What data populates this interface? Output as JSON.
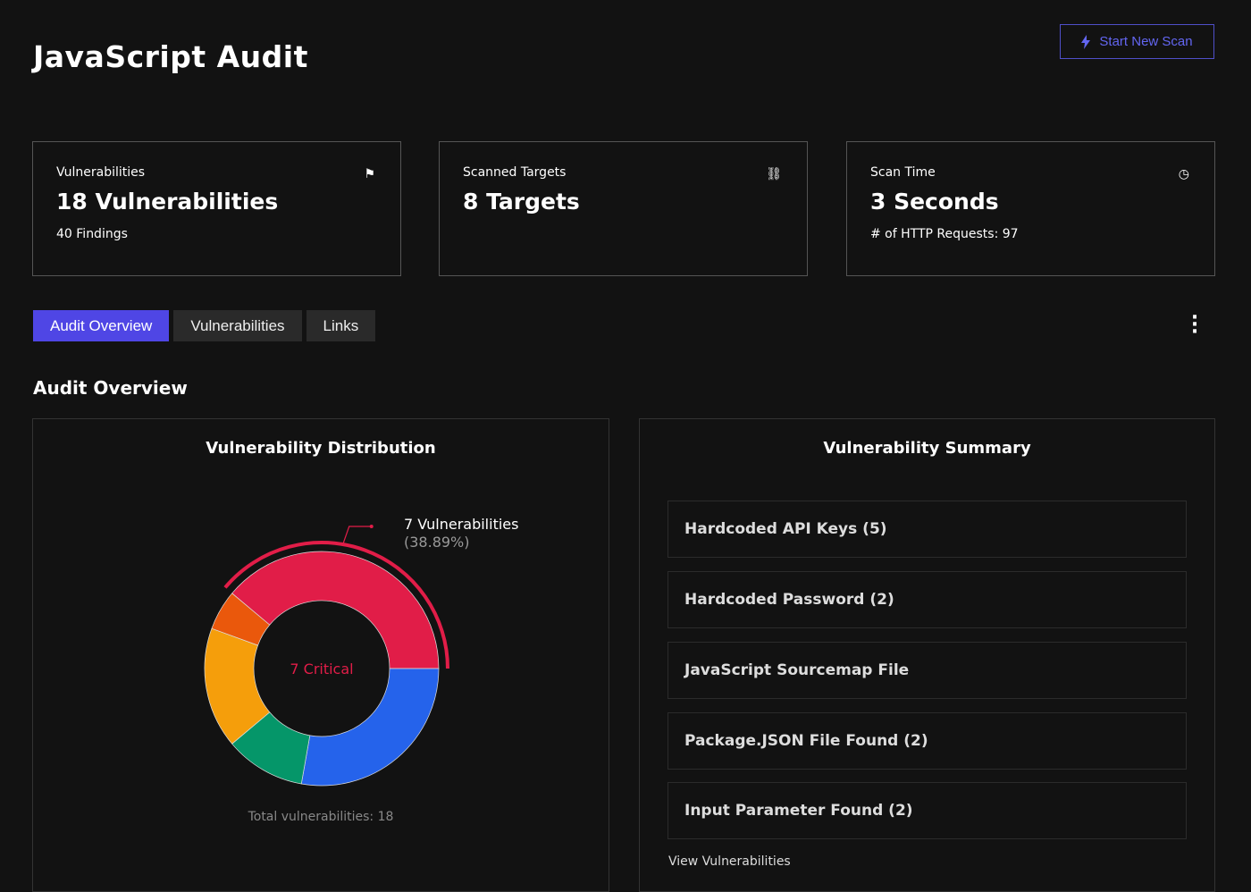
{
  "header": {
    "title": "JavaScript Audit",
    "scan_button": "Start New Scan"
  },
  "cards": [
    {
      "label": "Vulnerabilities",
      "value": "18 Vulnerabilities",
      "sub": "40 Findings",
      "icon": "flag-icon"
    },
    {
      "label": "Scanned Targets",
      "value": "8 Targets",
      "sub": "",
      "icon": "link-icon"
    },
    {
      "label": "Scan Time",
      "value": "3 Seconds",
      "sub": "# of HTTP Requests: 97",
      "icon": "clock-icon"
    }
  ],
  "tabs": [
    {
      "label": "Audit Overview",
      "active": true
    },
    {
      "label": "Vulnerabilities"
    },
    {
      "label": "Links"
    }
  ],
  "section_title": "Audit Overview",
  "distribution": {
    "title": "Vulnerability Distribution",
    "center_label": "7 Critical",
    "callout_value": "7 Vulnerabilities",
    "callout_percent": "(38.89%)",
    "total": "Total vulnerabilities: 18"
  },
  "chart_data": {
    "type": "pie",
    "variant": "donut",
    "values": [
      7,
      5,
      2,
      3,
      1
    ],
    "colors": [
      "#e11d48",
      "#2563eb",
      "#059669",
      "#f59e0b",
      "#ea580c"
    ],
    "highlighted_index": 0
  },
  "summary": {
    "title": "Vulnerability Summary",
    "items": [
      "Hardcoded API Keys (5)",
      "Hardcoded Password (2)",
      "JavaScript Sourcemap File",
      "Package.JSON File Found (2)",
      "Input Parameter Found (2)"
    ],
    "view_link": "View Vulnerabilities"
  }
}
